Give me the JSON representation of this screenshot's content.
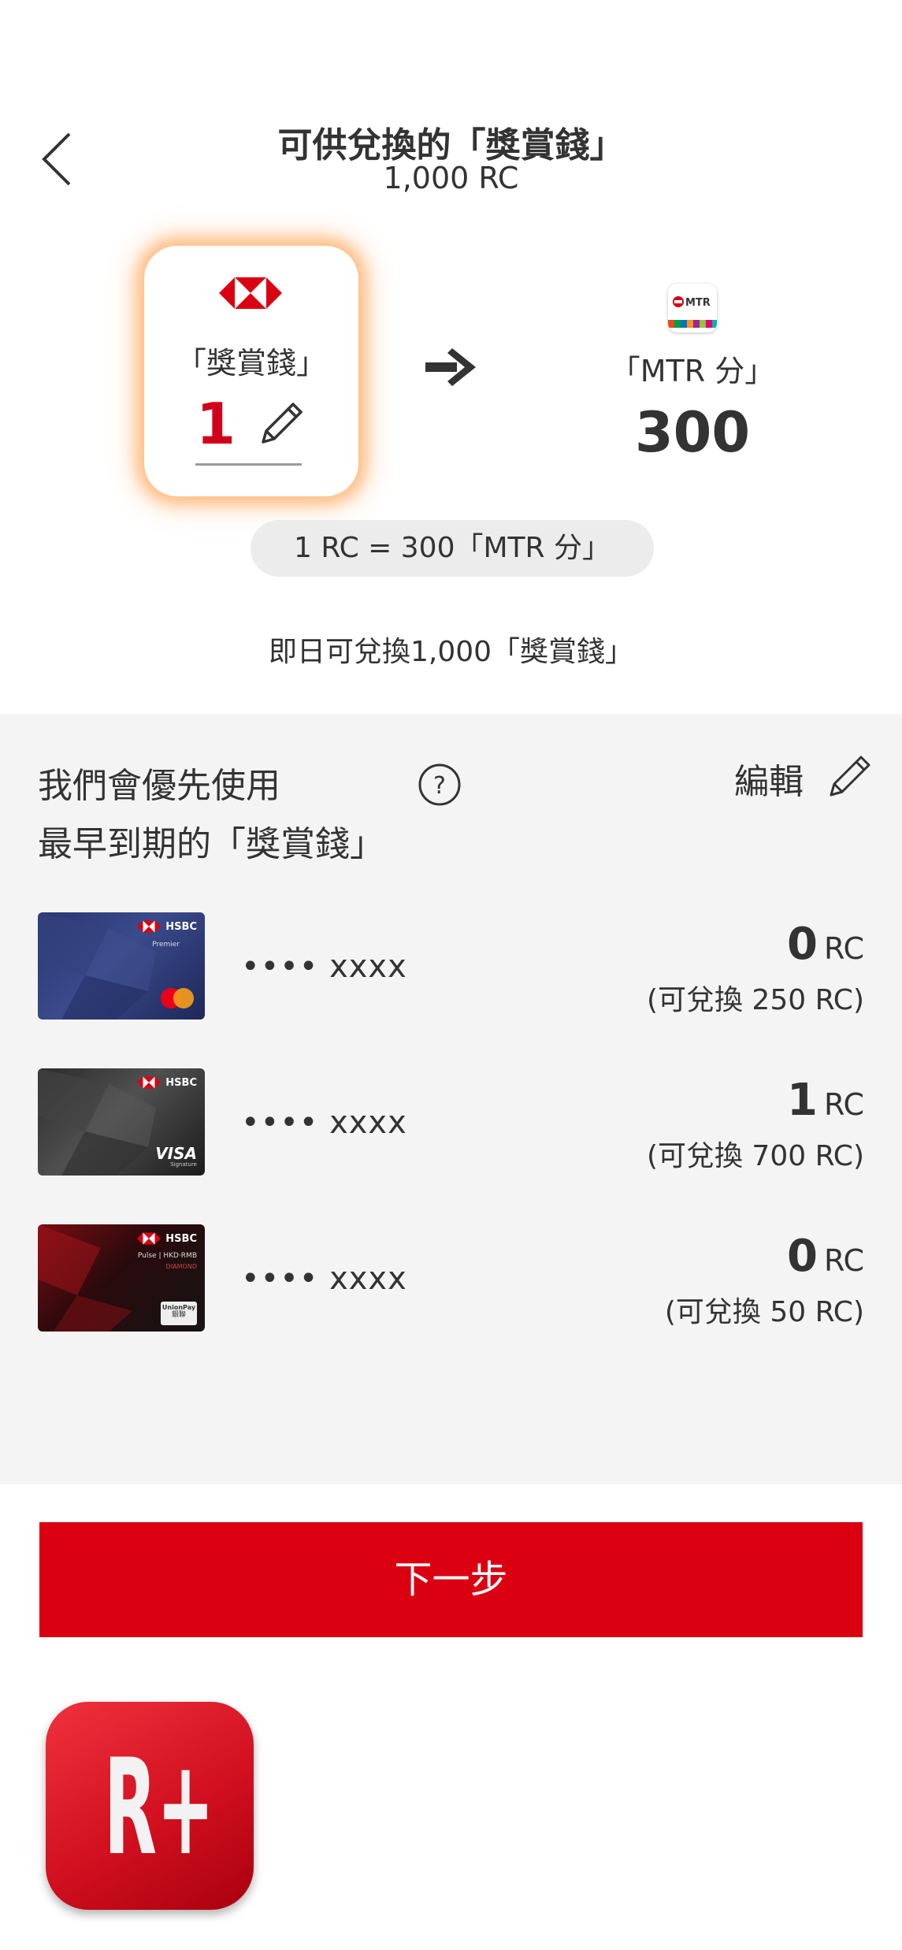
{
  "header": {
    "title": "可供兌換的「獎賞錢」",
    "subtitle": "1,000 RC"
  },
  "conversion": {
    "from_label": "「獎賞錢」",
    "from_value": "1",
    "to_label": "「MTR 分」",
    "to_value": "300",
    "mtr_logo_text": "MTR",
    "rate": "1 RC = 300「MTR 分」",
    "instant": "即日可兌換1,000「獎賞錢」"
  },
  "priority": {
    "line1": "我們會優先使用",
    "line2": "最早到期的「獎賞錢」",
    "edit_label": "編輯"
  },
  "cards": [
    {
      "number": "•••• xxxx",
      "rc_value": "0",
      "rc_unit": "RC",
      "available": "(可兌換 250 RC)",
      "brand": "HSBC",
      "tier": "Premier",
      "network": "mastercard"
    },
    {
      "number": "•••• xxxx",
      "rc_value": "1",
      "rc_unit": "RC",
      "available": "(可兌換 700 RC)",
      "brand": "HSBC",
      "tier": "",
      "network": "VISA",
      "network_sub": "Signature"
    },
    {
      "number": "•••• xxxx",
      "rc_value": "0",
      "rc_unit": "RC",
      "available": "(可兌換 50 RC)",
      "brand": "HSBC",
      "tier": "Pulse | HKD·RMB",
      "tier2": "DIAMOND",
      "network": "UnionPay",
      "network_sub": "銀聯"
    }
  ],
  "footer": {
    "next_label": "下一步",
    "app_icon_text": "R+"
  },
  "colors": {
    "hsbc_red": "#db0011",
    "highlight_glow": "#ffa050",
    "section_bg": "#f4f4f4"
  }
}
